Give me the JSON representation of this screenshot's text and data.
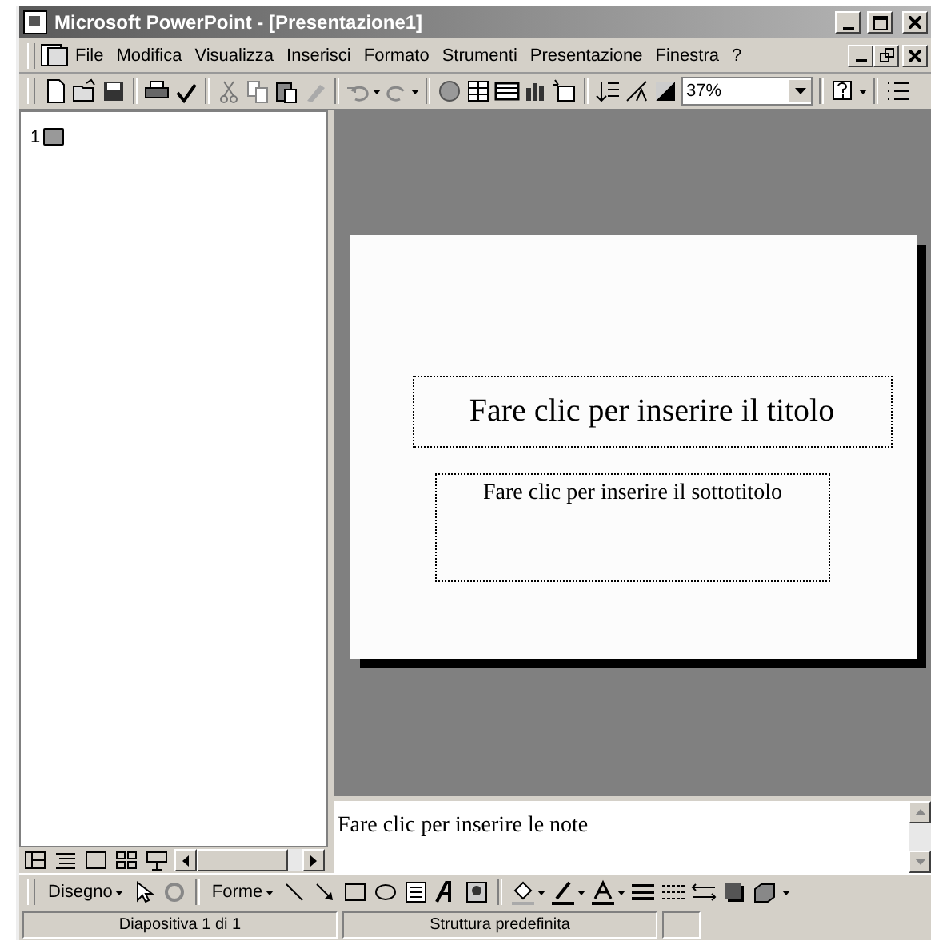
{
  "window": {
    "title": "Microsoft PowerPoint - [Presentazione1]"
  },
  "menu": [
    "File",
    "Modifica",
    "Visualizza",
    "Inserisci",
    "Formato",
    "Strumenti",
    "Presentazione",
    "Finestra",
    "?"
  ],
  "toolbar": {
    "zoom": "37%"
  },
  "outline": {
    "slide_number": "1"
  },
  "slide": {
    "title_placeholder": "Fare clic per inserire il titolo",
    "subtitle_placeholder": "Fare clic per inserire il sottotitolo"
  },
  "notes": {
    "placeholder": "Fare clic per inserire le note"
  },
  "drawing_toolbar": {
    "draw_menu": "Disegno",
    "shapes_menu": "Forme"
  },
  "status_bar": [
    "Diapositiva 1 di 1",
    "Struttura predefinita"
  ]
}
